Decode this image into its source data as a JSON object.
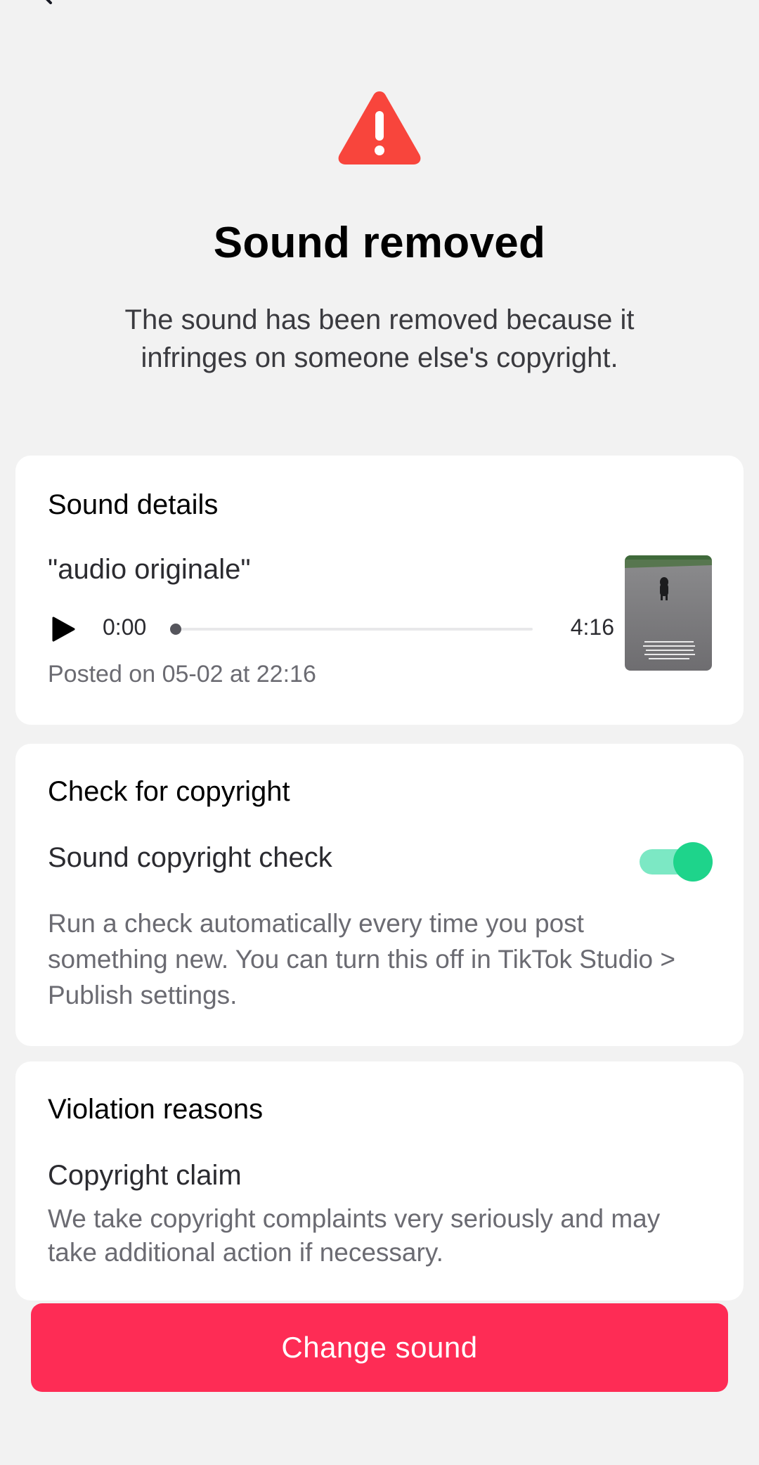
{
  "header": {
    "title": "Sound removed",
    "subtitle": "The sound has been removed because it infringes on someone else's copyright."
  },
  "colors": {
    "warning": "#f8453c",
    "accent": "#fe2c55",
    "toggle_on": "#1ed48b"
  },
  "icons": {
    "back": "chevron-left-icon",
    "warning": "warning-triangle-icon",
    "play": "play-icon"
  },
  "sound_details": {
    "title": "Sound details",
    "track_name": "\"audio originale\"",
    "time_current": "0:00",
    "time_total": "4:16",
    "progress": 0,
    "posted": "Posted on 05-02 at 22:16"
  },
  "copyright_check": {
    "title": "Check for copyright",
    "label": "Sound copyright check",
    "enabled": true,
    "description": "Run a check automatically every time you post something new. You can turn this off in TikTok Studio > Publish settings."
  },
  "violation": {
    "title": "Violation reasons",
    "claim_title": "Copyright claim",
    "claim_text": "We take copyright complaints very seriously and may take additional action if necessary."
  },
  "actions": {
    "primary_label": "Change sound"
  }
}
